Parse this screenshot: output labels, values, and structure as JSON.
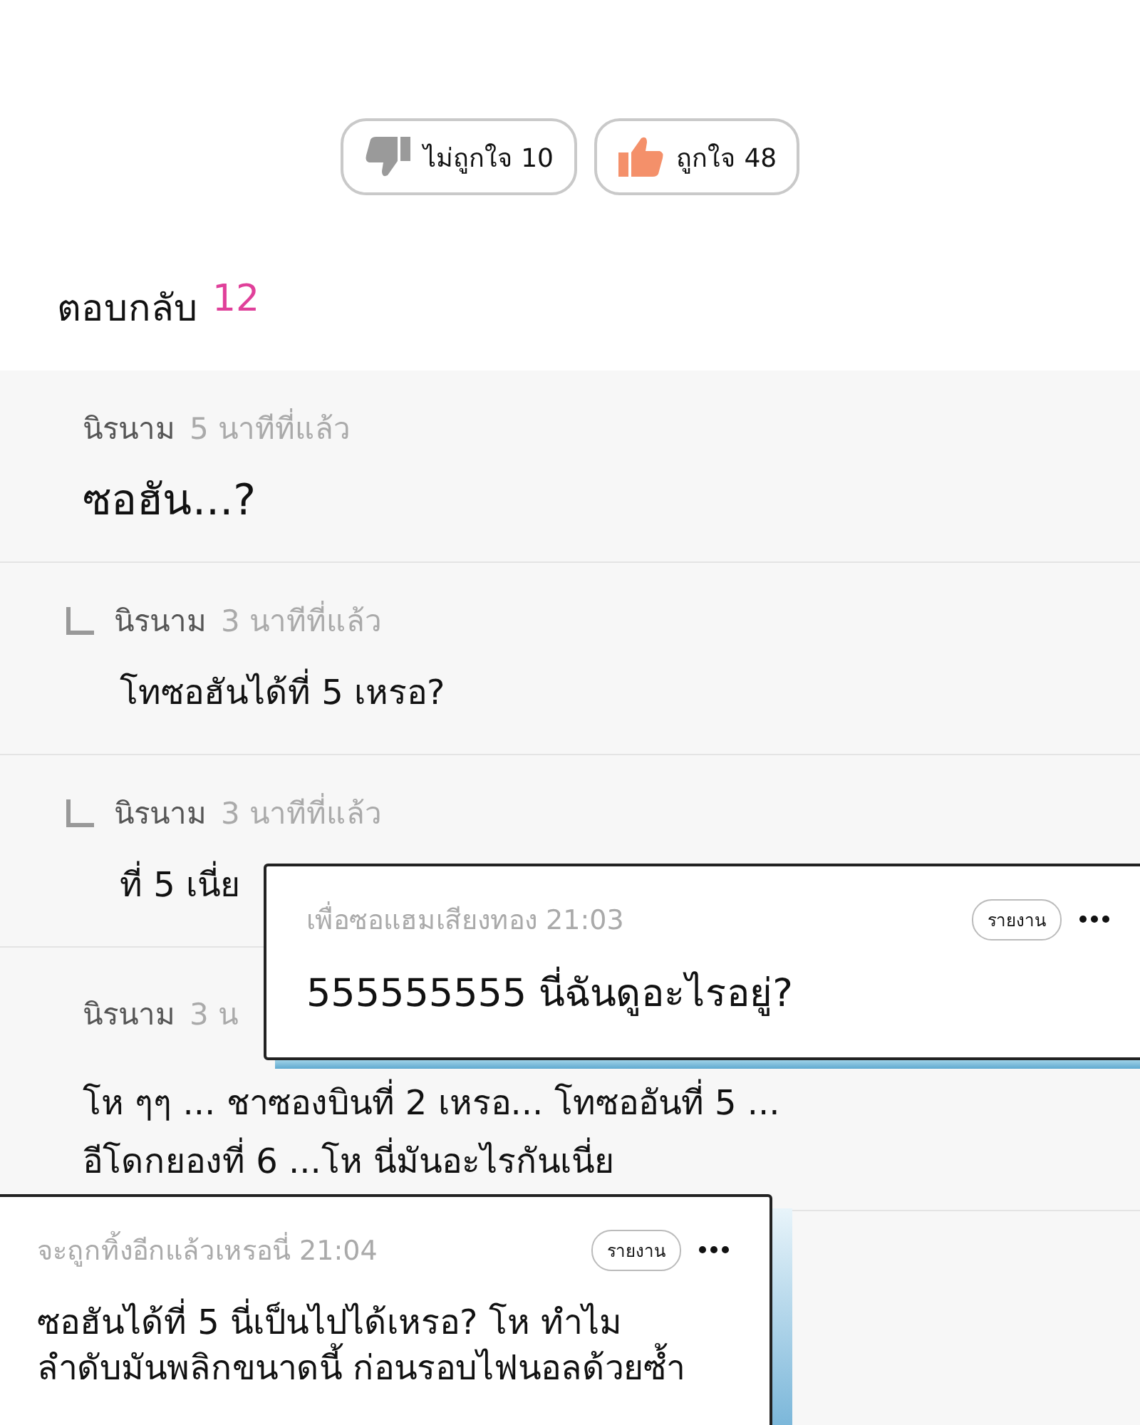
{
  "reactions": [
    {
      "kind": "dislike",
      "label": "ไม่ถูกใจ",
      "count": "10"
    },
    {
      "kind": "like",
      "label": "ถูกใจ",
      "count": "48"
    }
  ],
  "replies_header": {
    "label": "ตอบกลับ",
    "count": "12"
  },
  "comments": [
    {
      "kind": "comment",
      "author": "นิรนาม",
      "time": "5 นาทีที่แล้ว",
      "lines": [
        "ซอฮัน...?"
      ]
    },
    {
      "kind": "reply",
      "author": "นิรนาม",
      "time": "3 นาทีที่แล้ว",
      "lines": [
        "โทซอฮันได้ที่ 5 เหรอ?"
      ]
    },
    {
      "kind": "reply",
      "author": "นิรนาม",
      "time": "3 นาทีที่แล้ว",
      "lines": [
        "ที่ 5 เนี่ย"
      ]
    },
    {
      "kind": "comment",
      "author": "นิรนาม",
      "time": "3 น",
      "lines": [
        "โห ๆๆ ... ชาซองบินที่ 2 เหรอ... โทซออันที่ 5 ...",
        "อีโดกยองที่ 6 ...โห นี่มันอะไรกันเนี่ย"
      ]
    },
    {
      "kind": "comment"
    }
  ],
  "popups": [
    {
      "author": "เพื่อซอแฮมเสียงทอง",
      "time": "21:03",
      "report": "รายงาน",
      "body": "555555555 นี่ฉันดูอะไรอยู่?"
    },
    {
      "author": "จะถูกทิ้งอีกแล้วเหรอนี่",
      "time": "21:04",
      "report": "รายงาน",
      "body": "ซอฮันได้ที่ 5 นี่เป็นไปได้เหรอ? โห ทำไมลำดับมันพลิกขนาดนี้ ก่อนรอบไฟนอลด้วยซ้ำ"
    }
  ]
}
